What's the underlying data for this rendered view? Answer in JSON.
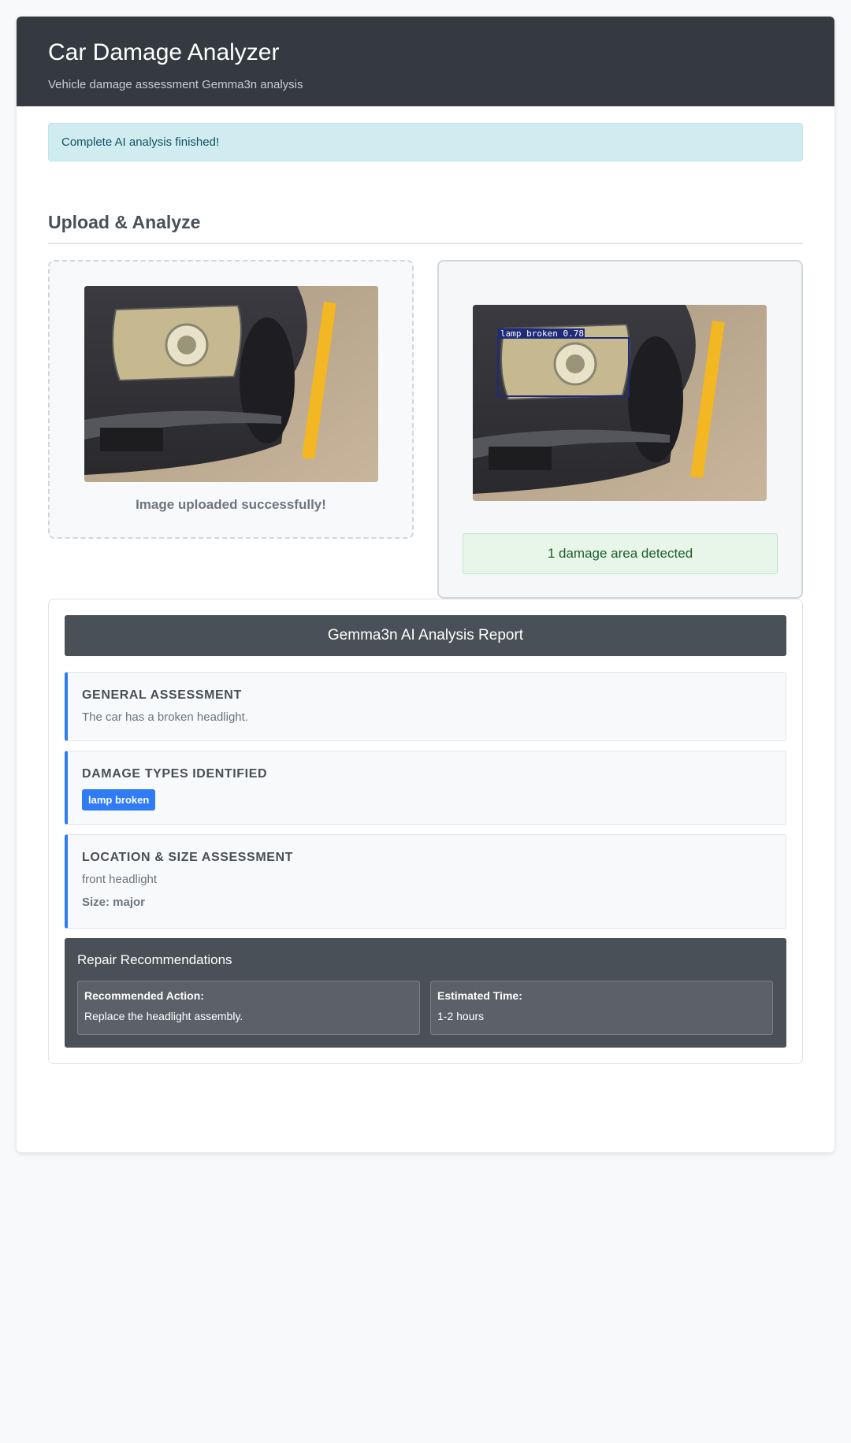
{
  "header": {
    "title": "Car Damage Analyzer",
    "subtitle": "Vehicle damage assessment Gemma3n analysis"
  },
  "alert": {
    "text": "Complete AI analysis finished!"
  },
  "upload_section": {
    "title": "Upload & Analyze",
    "upload_status": "Image uploaded successfully!",
    "detection_label": "lamp broken 0.78",
    "detection_summary": "1 damage area detected"
  },
  "report": {
    "title": "Gemma3n AI Analysis Report",
    "general": {
      "heading": "GENERAL ASSESSMENT",
      "text": "The car has a broken headlight."
    },
    "damage_types": {
      "heading": "DAMAGE TYPES IDENTIFIED",
      "tags": [
        "lamp broken"
      ]
    },
    "location": {
      "heading": "LOCATION & SIZE ASSESSMENT",
      "text": "front headlight",
      "size": "Size: major"
    },
    "repair": {
      "heading": "Repair Recommendations",
      "action_label": "Recommended Action:",
      "action_value": "Replace the headlight assembly.",
      "time_label": "Estimated Time:",
      "time_value": "1-2 hours"
    }
  },
  "colors": {
    "header_bg": "#343a40",
    "accent": "#2f7cf6",
    "alert_bg": "#d1ecf1",
    "success_bg": "#e8f5e9",
    "report_head_bg": "#495057"
  },
  "icons": {
    "car_photo": "car-headlight-photo",
    "car_photo_annotated": "car-headlight-photo-with-detection-box"
  }
}
